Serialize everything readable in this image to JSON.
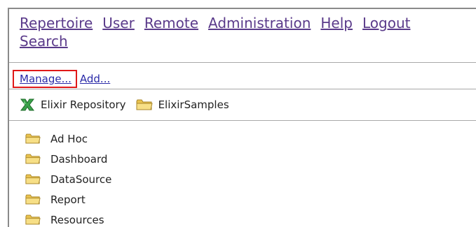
{
  "nav": {
    "items": [
      "Repertoire",
      "User",
      "Remote",
      "Administration",
      "Help",
      "Logout"
    ],
    "search_label": "Search"
  },
  "toolbar": {
    "manage_label": "Manage...",
    "add_label": "Add..."
  },
  "breadcrumb": {
    "root_label": "Elixir Repository",
    "current_label": "ElixirSamples"
  },
  "folders": [
    "Ad Hoc",
    "Dashboard",
    "DataSource",
    "Report",
    "Resources"
  ],
  "colors": {
    "nav_link": "#5a3a8a",
    "action_link": "#2a2aa8",
    "highlight_box": "#e01818",
    "folder_fill": "#f2d675",
    "folder_stroke": "#a8862a",
    "repository_icon": "#2e8b3a"
  },
  "icons": {
    "root": "elixir-repository-icon",
    "folder": "folder-icon"
  }
}
